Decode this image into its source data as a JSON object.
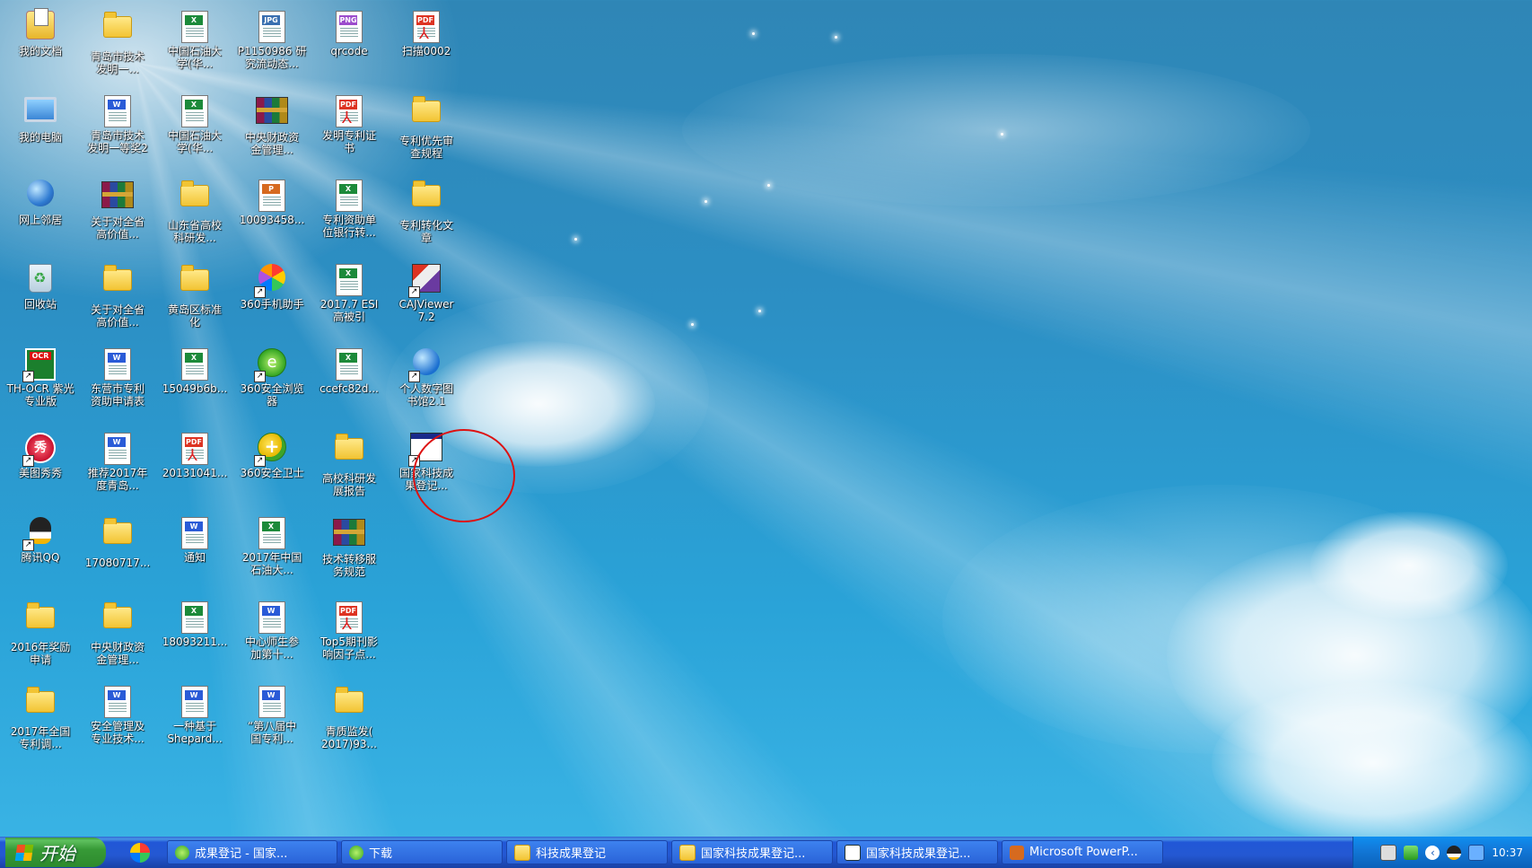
{
  "desktop": {
    "icons": [
      {
        "label": "我的文档",
        "type": "mydocs"
      },
      {
        "label": "青岛市技术\n发明一...",
        "type": "folder"
      },
      {
        "label": "中国石油大\n学(华...",
        "type": "excel"
      },
      {
        "label": "P1150986 研\n究流动态...",
        "type": "jpg"
      },
      {
        "label": "qrcode",
        "type": "png"
      },
      {
        "label": "扫描0002",
        "type": "pdf"
      },
      {
        "label": "我的电脑",
        "type": "pc"
      },
      {
        "label": "青岛市技术\n发明一等奖2",
        "type": "word"
      },
      {
        "label": "中国石油大\n学(华...",
        "type": "excel"
      },
      {
        "label": "中央财政资\n金管理...",
        "type": "rar"
      },
      {
        "label": "发明专利证\n书",
        "type": "pdf"
      },
      {
        "label": "专利优先审\n查规程",
        "type": "folder"
      },
      {
        "label": "网上邻居",
        "type": "net"
      },
      {
        "label": "关于对全省\n高价值...",
        "type": "rar"
      },
      {
        "label": "山东省高校\n科研发...",
        "type": "folder"
      },
      {
        "label": "10093458...",
        "type": "ppt"
      },
      {
        "label": "专利资助单\n位银行转...",
        "type": "excel"
      },
      {
        "label": "专利转化文\n章",
        "type": "folder"
      },
      {
        "label": "回收站",
        "type": "bin"
      },
      {
        "label": "关于对全省\n高价值...",
        "type": "folder"
      },
      {
        "label": "黄岛区标准\n化",
        "type": "folder"
      },
      {
        "label": "360手机助手",
        "type": "360phone"
      },
      {
        "label": "2017.7 ESI\n高被引",
        "type": "excel"
      },
      {
        "label": "CAJViewer\n7.2",
        "type": "caj"
      },
      {
        "label": "TH-OCR 紫光\n专业版",
        "type": "ocr"
      },
      {
        "label": "东营市专利\n资助申请表",
        "type": "word"
      },
      {
        "label": "15049b6b...",
        "type": "excel"
      },
      {
        "label": "360安全浏览\n器",
        "type": "360browser"
      },
      {
        "label": "ccefc82d...",
        "type": "excel"
      },
      {
        "label": "个人数字图\n书馆2.1",
        "type": "library"
      },
      {
        "label": "美图秀秀",
        "type": "meitu"
      },
      {
        "label": "推荐2017年\n度青岛...",
        "type": "word"
      },
      {
        "label": "20131041...",
        "type": "pdf"
      },
      {
        "label": "360安全卫士",
        "type": "360safe"
      },
      {
        "label": "高校科研发\n展报告",
        "type": "folder"
      },
      {
        "label": "国家科技成\n果登记...",
        "type": "window"
      },
      {
        "label": "腾讯QQ",
        "type": "qq"
      },
      {
        "label": "17080717...",
        "type": "folder"
      },
      {
        "label": "通知",
        "type": "word"
      },
      {
        "label": "2017年中国\n石油大...",
        "type": "excel"
      },
      {
        "label": "技术转移服\n务规范",
        "type": "rar"
      },
      {
        "label": "2016年奖励\n申请",
        "type": "folder"
      },
      {
        "label": "中央财政资\n金管理...",
        "type": "folder"
      },
      {
        "label": "18093211...",
        "type": "excel"
      },
      {
        "label": "中心师生参\n加第十...",
        "type": "word"
      },
      {
        "label": "Top5期刊影\n响因子点...",
        "type": "pdf"
      },
      {
        "label": "2017年全国\n专利调...",
        "type": "folder"
      },
      {
        "label": "安全管理及\n专业技术...",
        "type": "word"
      },
      {
        "label": "一种基于\nShepard...",
        "type": "word"
      },
      {
        "label": "“第八届中\n国专利...",
        "type": "word"
      },
      {
        "label": "青质监发(\n2017)93...",
        "type": "folder"
      }
    ]
  },
  "taskbar": {
    "start_label": "开始",
    "tasks": [
      {
        "label": "成果登记 - 国家...",
        "icon": "browser"
      },
      {
        "label": "下载",
        "icon": "browser"
      },
      {
        "label": "科技成果登记",
        "icon": "folder"
      },
      {
        "label": "国家科技成果登记...",
        "icon": "folder"
      },
      {
        "label": "国家科技成果登记...",
        "icon": "app"
      },
      {
        "label": "Microsoft PowerP...",
        "icon": "ppt"
      }
    ],
    "clock": "10:37"
  }
}
